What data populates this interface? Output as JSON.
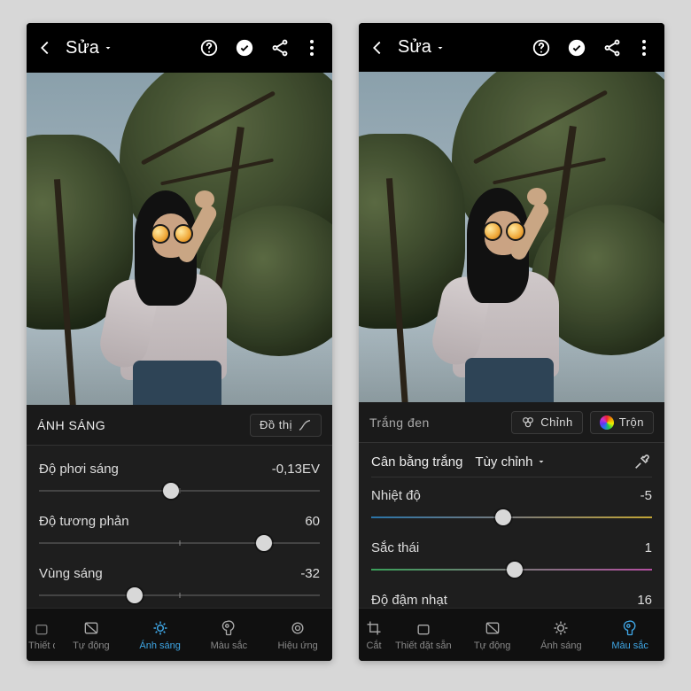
{
  "left": {
    "header": {
      "title": "Sửa"
    },
    "panel_title": "ÁNH SÁNG",
    "graph_label": "Đồ thị",
    "sliders": [
      {
        "name": "Độ phơi sáng",
        "value": "-0,13EV",
        "pos": 47
      },
      {
        "name": "Độ tương phản",
        "value": "60",
        "pos": 80
      },
      {
        "name": "Vùng sáng",
        "value": "-32",
        "pos": 34
      }
    ],
    "nav": [
      {
        "label": "Thiết đặt sẵn",
        "active": false,
        "cut": true
      },
      {
        "label": "Tự động",
        "active": false
      },
      {
        "label": "Ánh sáng",
        "active": true
      },
      {
        "label": "Màu sắc",
        "active": false
      },
      {
        "label": "Hiệu ứng",
        "active": false
      }
    ]
  },
  "right": {
    "header": {
      "title": "Sửa"
    },
    "bw_label": "Trắng đen",
    "adjust_label": "Chỉnh",
    "mix_label": "Trộn",
    "wb_label": "Cân bằng trắng",
    "wb_value": "Tùy chỉnh",
    "sliders": [
      {
        "name": "Nhiệt độ",
        "value": "-5",
        "pos": 47,
        "grad": "gradient1"
      },
      {
        "name": "Sắc thái",
        "value": "1",
        "pos": 51,
        "grad": "gradient2"
      },
      {
        "name": "Độ đậm nhạt",
        "value": "16",
        "pos": 58
      }
    ],
    "nav": [
      {
        "label": "Cắt",
        "active": false,
        "cut": true
      },
      {
        "label": "Thiết đặt sẵn",
        "active": false
      },
      {
        "label": "Tự động",
        "active": false
      },
      {
        "label": "Ánh sáng",
        "active": false
      },
      {
        "label": "Màu sắc",
        "active": true
      }
    ]
  }
}
